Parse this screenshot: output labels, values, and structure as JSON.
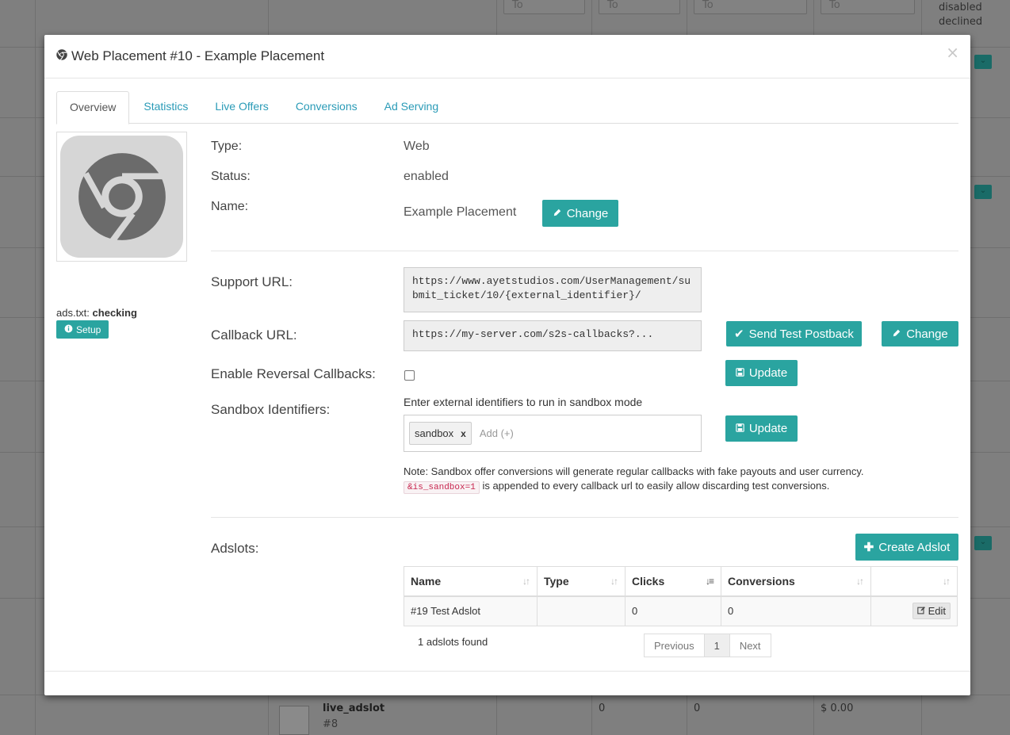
{
  "colors": {
    "accent": "#2aa4a0",
    "link": "#2a9bb7"
  },
  "background": {
    "filters": [
      "To",
      "To",
      "To",
      "To"
    ],
    "status_options": [
      "disabled",
      "declined"
    ],
    "row": {
      "name": "live_adslot",
      "id": "#8",
      "v1": "0",
      "v2": "0",
      "v3": "$ 0.00"
    }
  },
  "modal": {
    "title": "Web Placement #10 - Example Placement",
    "title_icon": "chrome-icon",
    "close": "×",
    "tabs": [
      "Overview",
      "Statistics",
      "Live Offers",
      "Conversions",
      "Ad Serving"
    ],
    "active_tab": "Overview"
  },
  "sidebar": {
    "adstxt_label": "ads.txt:",
    "adstxt_status": "checking",
    "setup_label": "Setup"
  },
  "overview": {
    "type_label": "Type:",
    "type_value": "Web",
    "status_label": "Status:",
    "status_value": "enabled",
    "name_label": "Name:",
    "name_value": "Example Placement",
    "change_label": "Change",
    "support_url_label": "Support URL:",
    "support_url": "https://www.ayetstudios.com/UserManagement/submit_ticket/10/{external_identifier}/",
    "callback_url_label": "Callback URL:",
    "callback_url": "https://my-server.com/s2s-callbacks?...",
    "send_test_label": "Send Test Postback",
    "callback_change_label": "Change",
    "reversal_label": "Enable Reversal Callbacks:",
    "reversal_checked": false,
    "update_label": "Update",
    "sandbox_label": "Sandbox Identifiers:",
    "sandbox_hint": "Enter external identifiers to run in sandbox mode",
    "sandbox_tags": [
      "sandbox"
    ],
    "sandbox_placeholder": "Add (+)",
    "sandbox_update_label": "Update",
    "note_line1": "Note: Sandbox offer conversions will generate regular callbacks with fake payouts and user currency.",
    "note_code": "&is_sandbox=1",
    "note_line2": "is appended to every callback url to easily allow discarding test conversions."
  },
  "adslots": {
    "label": "Adslots:",
    "create_label": "Create Adslot",
    "columns": [
      "Name",
      "Type",
      "Clicks",
      "Conversions",
      ""
    ],
    "rows": [
      {
        "name": "#19 Test Adslot",
        "type": "",
        "clicks": "0",
        "conversions": "0",
        "edit": "Edit"
      }
    ],
    "found_text": "1 adslots found",
    "pagination": {
      "prev": "Previous",
      "page": "1",
      "next": "Next"
    }
  }
}
